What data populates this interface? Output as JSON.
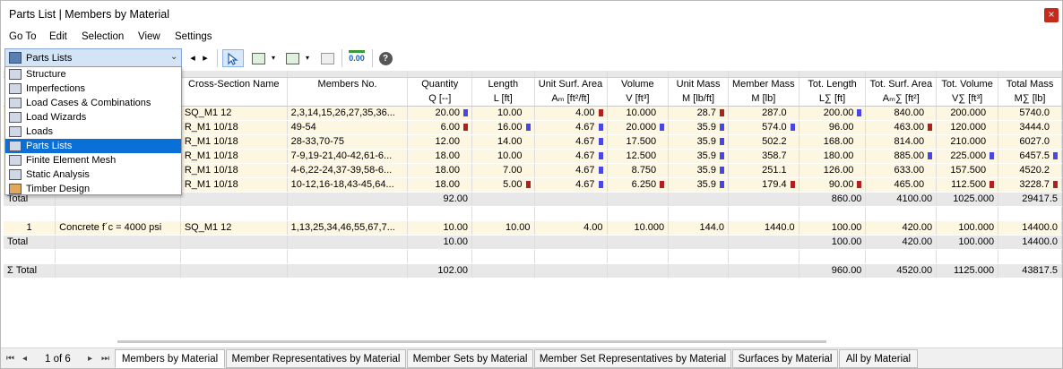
{
  "window": {
    "title": "Parts List | Members by Material",
    "close_glyph": "×"
  },
  "menu": [
    "Go To",
    "Edit",
    "Selection",
    "View",
    "Settings"
  ],
  "toolbar": {
    "combo_value": "Parts Lists",
    "combo_arrow": "⌄",
    "prev": "◂",
    "next": "▸",
    "units_label": "0.00",
    "help": "?"
  },
  "dropdown": {
    "items": [
      "Structure",
      "Imperfections",
      "Load Cases & Combinations",
      "Load Wizards",
      "Loads",
      "Parts Lists",
      "Finite Element Mesh",
      "Static Analysis",
      "Timber Design"
    ],
    "selected": "Parts Lists"
  },
  "table": {
    "headers1": [
      "",
      "",
      "Cross-Section Name",
      "Members No.",
      "Quantity",
      "Length",
      "Unit Surf. Area",
      "Volume",
      "Unit Mass",
      "Member Mass",
      "Tot. Length",
      "Tot. Surf. Area",
      "Tot. Volume",
      "Total Mass"
    ],
    "headers2": [
      "",
      "",
      "",
      "",
      "Q [--]",
      "L [ft]",
      "Aₘ [ft²/ft]",
      "V [ft³]",
      "M [lb/ft]",
      "M [lb]",
      "L∑ [ft]",
      "Aₘ∑ [ft²]",
      "V∑ [ft³]",
      "M∑ [lb]"
    ],
    "group1": [
      {
        "cs": "SQ_M1 12",
        "members": "2,3,14,15,26,27,35,36...",
        "q": "20.00",
        "qm": "b",
        "l": "10.00",
        "lm": "n",
        "a": "4.00",
        "am": "r2",
        "v": "10.000",
        "vm": "n",
        "um": "28.7",
        "umm": "r2",
        "mm": "287.0",
        "mmm": "n",
        "tl": "200.00",
        "tlm": "b",
        "ta": "840.00",
        "tam": "n",
        "tv": "200.000",
        "tvm": "n",
        "tm": "5740.0",
        "tmm": "n"
      },
      {
        "cs": "R_M1 10/18",
        "members": "49-54",
        "q": "6.00",
        "qm": "r2",
        "l": "16.00",
        "lm": "b",
        "a": "4.67",
        "am": "b",
        "v": "20.000",
        "vm": "b",
        "um": "35.9",
        "umm": "b",
        "mm": "574.0",
        "mmm": "b",
        "tl": "96.00",
        "tlm": "n",
        "ta": "463.00",
        "tam": "r2",
        "tv": "120.000",
        "tvm": "n",
        "tm": "3444.0",
        "tmm": "n"
      },
      {
        "cs": "R_M1 10/18",
        "members": "28-33,70-75",
        "q": "12.00",
        "qm": "n",
        "l": "14.00",
        "lm": "n",
        "a": "4.67",
        "am": "b",
        "v": "17.500",
        "vm": "n",
        "um": "35.9",
        "umm": "b",
        "mm": "502.2",
        "mmm": "n",
        "tl": "168.00",
        "tlm": "n",
        "ta": "814.00",
        "tam": "n",
        "tv": "210.000",
        "tvm": "n",
        "tm": "6027.0",
        "tmm": "n"
      },
      {
        "cs": "R_M1 10/18",
        "members": "7-9,19-21,40-42,61-6...",
        "q": "18.00",
        "qm": "n",
        "l": "10.00",
        "lm": "n",
        "a": "4.67",
        "am": "b",
        "v": "12.500",
        "vm": "n",
        "um": "35.9",
        "umm": "b",
        "mm": "358.7",
        "mmm": "n",
        "tl": "180.00",
        "tlm": "n",
        "ta": "885.00",
        "tam": "b",
        "tv": "225.000",
        "tvm": "b",
        "tm": "6457.5",
        "tmm": "b"
      },
      {
        "cs": "R_M1 10/18",
        "members": "4-6,22-24,37-39,58-6...",
        "q": "18.00",
        "qm": "n",
        "l": "7.00",
        "lm": "n",
        "a": "4.67",
        "am": "b",
        "v": "8.750",
        "vm": "n",
        "um": "35.9",
        "umm": "b",
        "mm": "251.1",
        "mmm": "n",
        "tl": "126.00",
        "tlm": "n",
        "ta": "633.00",
        "tam": "n",
        "tv": "157.500",
        "tvm": "n",
        "tm": "4520.2",
        "tmm": "n"
      },
      {
        "cs": "R_M1 10/18",
        "members": "10-12,16-18,43-45,64...",
        "q": "18.00",
        "qm": "n",
        "l": "5.00",
        "lm": "r2",
        "a": "4.67",
        "am": "b",
        "v": "6.250",
        "vm": "r2",
        "um": "35.9",
        "umm": "b",
        "mm": "179.4",
        "mmm": "r2",
        "tl": "90.00",
        "tlm": "r2",
        "ta": "465.00",
        "tam": "n",
        "tv": "112.500",
        "tvm": "r2",
        "tm": "3228.7",
        "tmm": "r2"
      }
    ],
    "total1": {
      "label": "Total",
      "q": "92.00",
      "tl": "860.00",
      "ta": "4100.00",
      "tv": "1025.000",
      "tm": "29417.5"
    },
    "group2": {
      "no": "1",
      "material": "Concrete f´c = 4000 psi",
      "cs": "SQ_M1 12",
      "members": "1,13,25,34,46,55,67,7...",
      "q": "10.00",
      "l": "10.00",
      "a": "4.00",
      "v": "10.000",
      "um": "144.0",
      "mm": "1440.0",
      "tl": "100.00",
      "ta": "420.00",
      "tv": "100.000",
      "tm": "14400.0"
    },
    "total2": {
      "label": "Total",
      "q": "10.00",
      "tl": "100.00",
      "ta": "420.00",
      "tv": "100.000",
      "tm": "14400.0"
    },
    "grand": {
      "label": "Σ Total",
      "q": "102.00",
      "tl": "960.00",
      "ta": "4520.00",
      "tv": "1125.000",
      "tm": "43817.5"
    }
  },
  "pager": {
    "text": "1 of 6",
    "first": "⏮",
    "prev": "◂",
    "next": "▸",
    "last": "⏭"
  },
  "tabs": [
    "Members by Material",
    "Member Representatives by Material",
    "Member Sets by Material",
    "Member Set Representatives by Material",
    "Surfaces by Material",
    "All by Material"
  ],
  "active_tab": "Members by Material"
}
